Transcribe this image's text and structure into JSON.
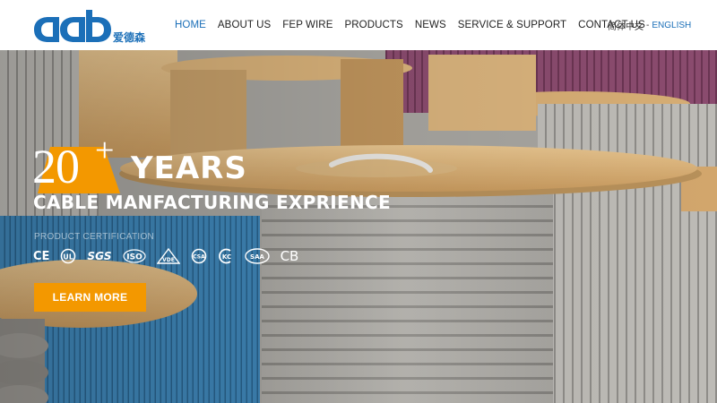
{
  "brand": {
    "logo_letters": "adb",
    "logo_cn": "爱德森",
    "accent": "#1b6fb8"
  },
  "nav": {
    "items": [
      {
        "label": "HOME",
        "active": true
      },
      {
        "label": "ABOUT US"
      },
      {
        "label": "FEP WIRE"
      },
      {
        "label": "PRODUCTS"
      },
      {
        "label": "NEWS"
      },
      {
        "label": "SERVICE & SUPPORT"
      },
      {
        "label": "CONTACT US"
      }
    ]
  },
  "lang": {
    "cn": "简体中文",
    "sep": "-",
    "en": "ENGLISH"
  },
  "hero": {
    "years_number": "20",
    "years_plus": "+",
    "years_word": "YEARS",
    "subtitle": "CABLE MANFACTURING EXPRIENCE",
    "cert_label": "PRODUCT CERTIFICATION",
    "certs": [
      "CE",
      "UL",
      "SGS",
      "ISO",
      "VDE",
      "CSA",
      "KC",
      "SAA",
      "CB"
    ],
    "button_label": "LEARN MORE",
    "button_color": "#f39800",
    "badge_color": "#f39800"
  }
}
